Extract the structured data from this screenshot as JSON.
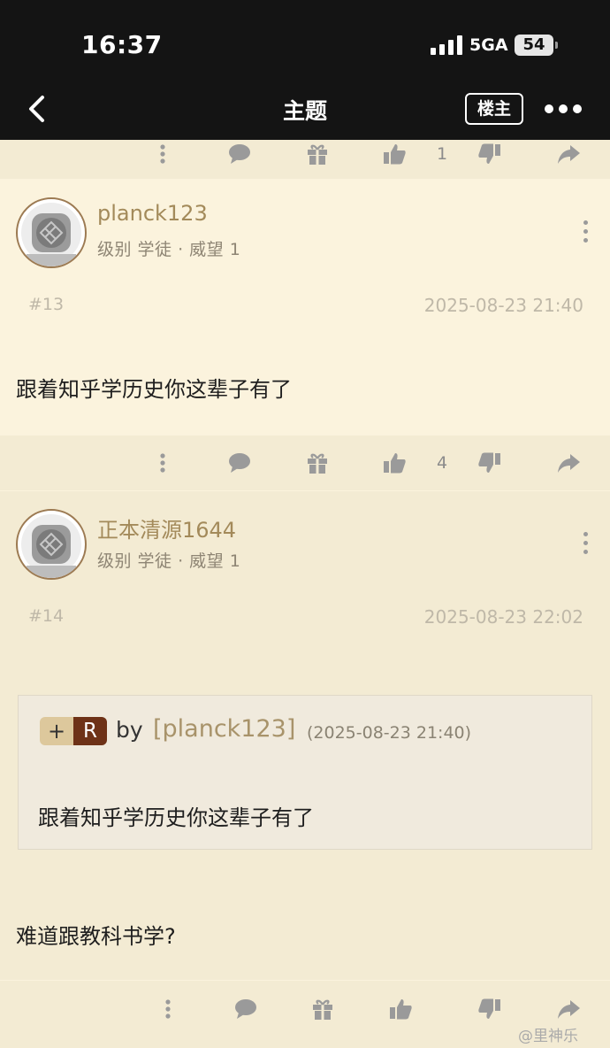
{
  "status_bar": {
    "time": "16:37",
    "network": "5GA",
    "battery": "54"
  },
  "nav": {
    "title": "主题",
    "owner_button": "楼主"
  },
  "action_bar_top": {
    "like_count": "1"
  },
  "posts": [
    {
      "username": "planck123",
      "level": "级别 学徒 · 威望 1",
      "floor": "#13",
      "time": "2025-08-23 21:40",
      "content": "跟着知乎学历史你这辈子有了",
      "like_count": "4"
    },
    {
      "username": "正本清源1644",
      "level": "级别 学徒 · 威望 1",
      "floor": "#14",
      "time": "2025-08-23 22:02",
      "quote": {
        "plus": "+",
        "r": "R",
        "by": "by",
        "user": "[planck123]",
        "time": "(2025-08-23 21:40)",
        "text": "跟着知乎学历史你这辈子有了"
      },
      "content": "难道跟教科书学?"
    }
  ],
  "watermark": "@里神乐",
  "icons": [
    "back-icon",
    "more-icon",
    "comment-icon",
    "gift-icon",
    "like-icon",
    "dislike-icon",
    "share-icon",
    "avatar-icon"
  ],
  "colors": {
    "topbar": "#141414",
    "page_bg": "#fbf3dd",
    "action_bar": "#f3ebd3",
    "username": "#a38a5a",
    "r_tag": "#6e3217",
    "plus_tag": "#ddc89c"
  }
}
